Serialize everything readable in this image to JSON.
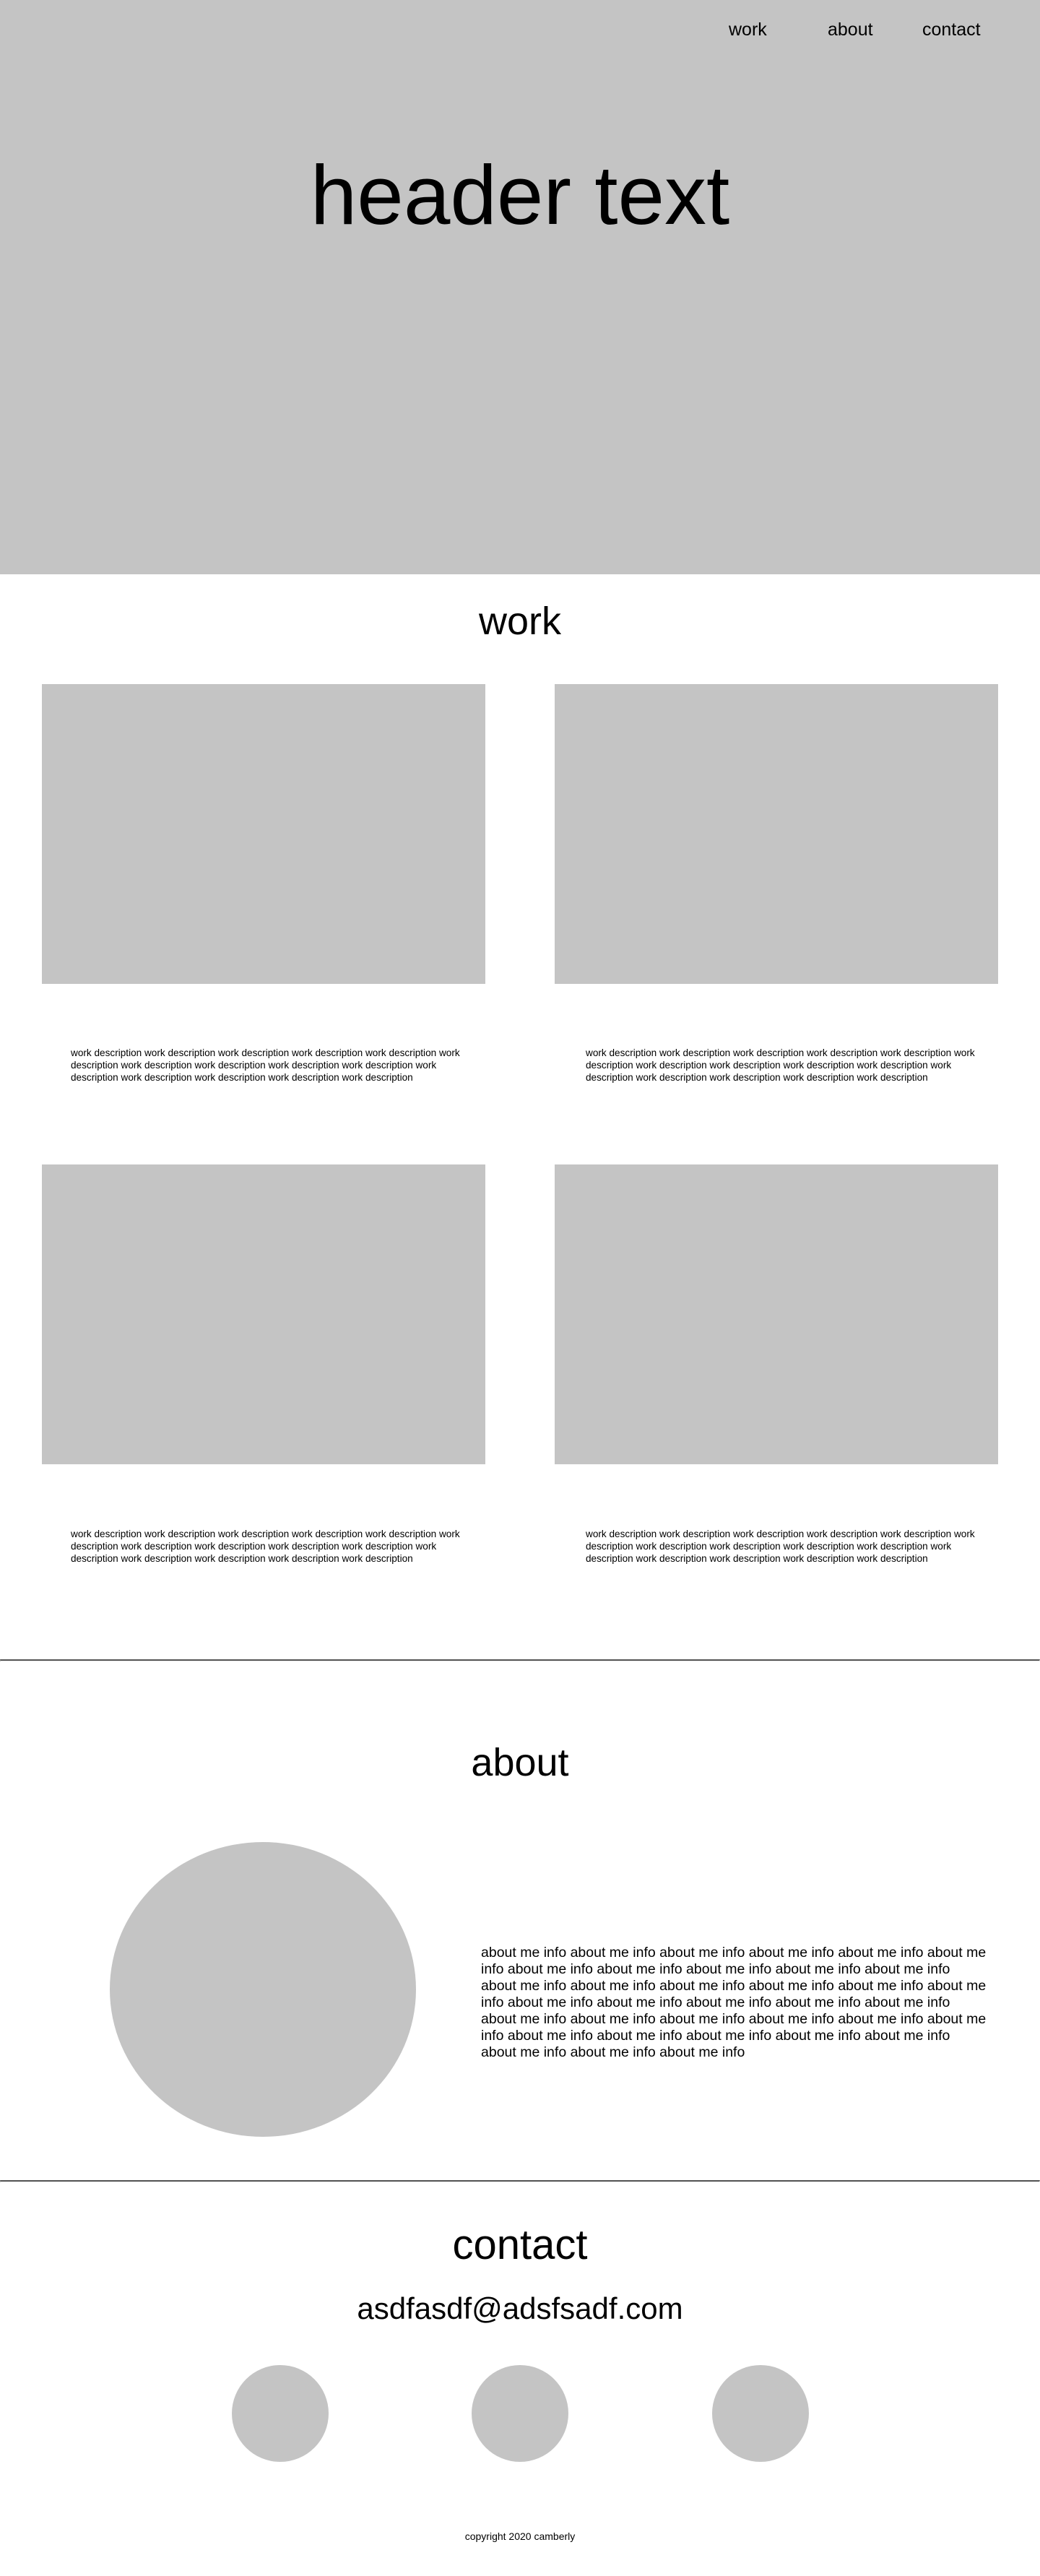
{
  "nav": {
    "work": "work",
    "about": "about",
    "contact": "contact"
  },
  "hero": {
    "title": "header text"
  },
  "work": {
    "title": "work",
    "items": [
      {
        "description": "work description work description work description work description work description work description work description work description work description work description work description work description work description work description work description"
      },
      {
        "description": "work description work description work description work description work description work description work description work description work description work description work description work description work description work description work description"
      },
      {
        "description": "work description work description work description work description work description work description work description work description work description work description work description work description work description work description work description"
      },
      {
        "description": "work description work description work description work description work description work description work description work description work description work description work description work description work description work description work description"
      }
    ]
  },
  "about": {
    "title": "about",
    "text": "about me info about me info about me info about me info about me info about me info about me info about me info about me info about me info about me info about me info about me info about me info about me info about me info about me info about me info about me info about me info about me info about me info about me info about me info about me info about me info about me info about me info about me info about me info about me info about me info about me info about me info about me info about me info"
  },
  "contact": {
    "title": "contact",
    "email": "asdfasdf@adsfsadf.com"
  },
  "footer": {
    "copyright": "copyright 2020 camberly"
  }
}
